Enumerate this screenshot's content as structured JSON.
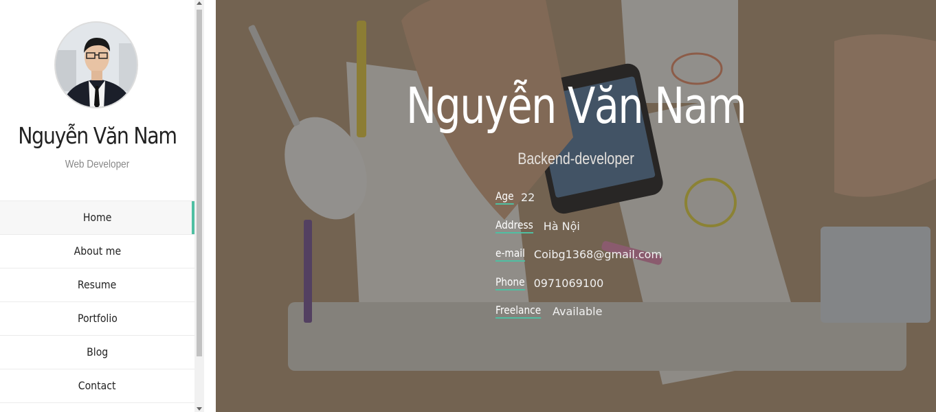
{
  "sidebar": {
    "name": "Nguyễn Văn Nam",
    "role": "Web Developer",
    "nav": [
      {
        "label": "Home",
        "active": true
      },
      {
        "label": "About me"
      },
      {
        "label": "Resume"
      },
      {
        "label": "Portfolio"
      },
      {
        "label": "Blog"
      },
      {
        "label": "Contact"
      }
    ]
  },
  "hero": {
    "name": "Nguyễn Văn Nam",
    "role": "Backend-developer",
    "info": [
      {
        "label": "Age",
        "value": "22"
      },
      {
        "label": "Address",
        "value": "Hà Nội"
      },
      {
        "label": "e-mail",
        "value": "Coibg1368@gmail.com"
      },
      {
        "label": "Phone",
        "value": "0971069100"
      },
      {
        "label": "Freelance",
        "value": "Available"
      }
    ]
  },
  "colors": {
    "accent": "#4fbfa2"
  }
}
